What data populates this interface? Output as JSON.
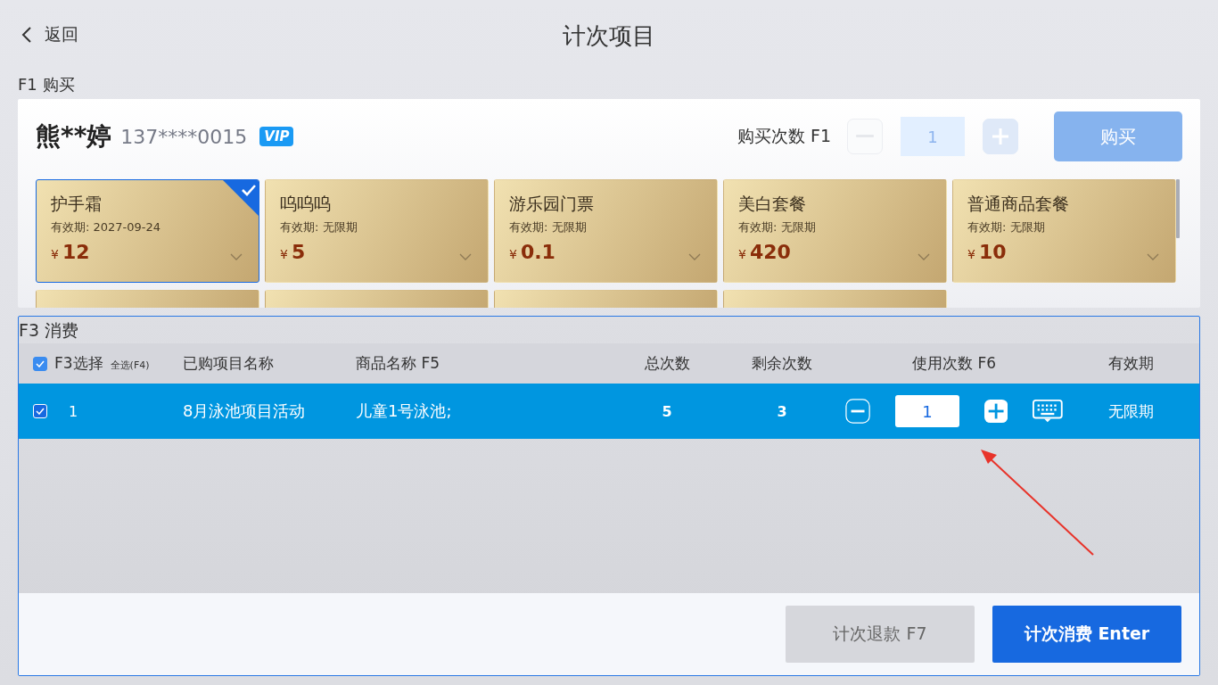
{
  "header": {
    "back": "返回",
    "title": "计次项目"
  },
  "purchase": {
    "section_label": "F1 购买",
    "customer_name": "熊**婷",
    "phone": "137****0015",
    "badge": "VIP",
    "count_label": "购买次数 F1",
    "count_value": "1",
    "minus_disabled": true,
    "buy_button": "购买",
    "buy_disabled": true,
    "cards": [
      {
        "name": "护手霜",
        "validity": "有效期: 2027-09-24",
        "currency": "¥",
        "price": "12",
        "selected": true
      },
      {
        "name": "呜呜呜",
        "validity": "有效期: 无限期",
        "currency": "¥",
        "price": "5",
        "selected": false
      },
      {
        "name": "游乐园门票",
        "validity": "有效期: 无限期",
        "currency": "¥",
        "price": "0.1",
        "selected": false
      },
      {
        "name": "美白套餐",
        "validity": "有效期: 无限期",
        "currency": "¥",
        "price": "420",
        "selected": false
      },
      {
        "name": "普通商品套餐",
        "validity": "有效期: 无限期",
        "currency": "¥",
        "price": "10",
        "selected": false
      }
    ],
    "partial_cards": [
      {
        "kind": "clipped"
      },
      {
        "kind": "clipped"
      },
      {
        "kind": "clipped"
      },
      {
        "kind": "clipped"
      }
    ]
  },
  "consume": {
    "section_label": "F3 消费",
    "select_all_checked": true,
    "columns": {
      "select": "F3选择",
      "select_all": "全选(F4)",
      "project": "已购项目名称",
      "goods": "商品名称 F5",
      "total": "总次数",
      "remaining": "剩余次数",
      "use": "使用次数 F6",
      "validity": "有效期"
    },
    "rows": [
      {
        "checked": true,
        "selected": true,
        "index": "1",
        "project": "8月泳池项目活动",
        "goods": "儿童1号泳池;",
        "total": "5",
        "remaining": "3",
        "use": "1",
        "validity": "无限期"
      }
    ],
    "refund_button": "计次退款 F7",
    "consume_button": "计次消费 Enter"
  }
}
